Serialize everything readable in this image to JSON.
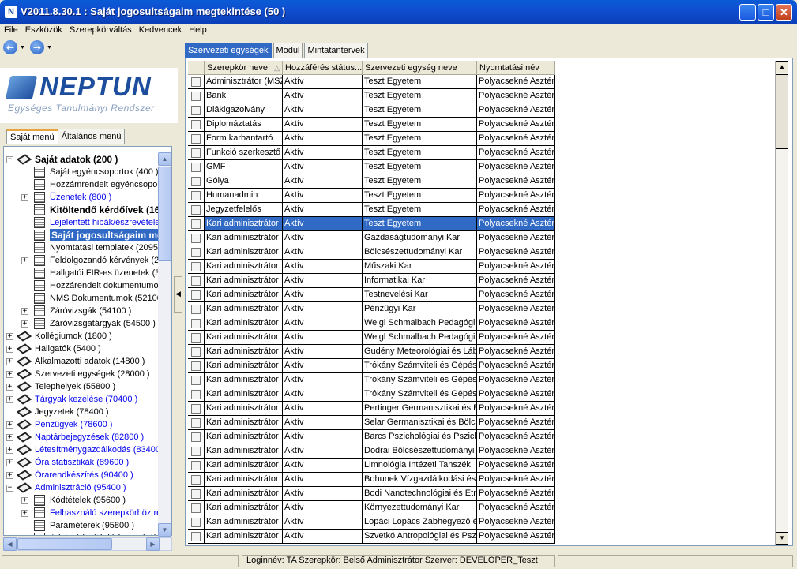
{
  "window": {
    "title": "V2011.8.30.1 : Saját jogosultságaim megtekintése (50  )",
    "app_icon": "N",
    "minimize": "_",
    "maximize": "□",
    "close": "✕"
  },
  "menu": [
    "File",
    "Eszközök",
    "Szerepkörváltás",
    "Kedvencek",
    "Help"
  ],
  "nav": {
    "back": "←",
    "forward": "→",
    "drop": "▼"
  },
  "logo": {
    "name": "NEPTUN",
    "subtitle": "Egységes Tanulmányi Rendszer"
  },
  "left_tabs": [
    "Saját menü",
    "Általános menü"
  ],
  "tree": [
    {
      "label": "Saját adatok (200  )",
      "level": 0,
      "exp": "−",
      "icon": "diamond",
      "style": "bold"
    },
    {
      "label": "Saját egyéncsoportok (400  )",
      "level": 1,
      "exp": "",
      "icon": "doc",
      "style": ""
    },
    {
      "label": "Hozzámrendelt egyéncsoportok",
      "level": 1,
      "exp": "",
      "icon": "doc",
      "style": ""
    },
    {
      "label": "Üzenetek (800  )",
      "level": 1,
      "exp": "+",
      "icon": "doc",
      "style": "link"
    },
    {
      "label": "Kitöltendő kérdőívek (16",
      "level": 1,
      "exp": "",
      "icon": "doc",
      "style": "bold"
    },
    {
      "label": "Lejelentett hibák/észrevételek",
      "level": 1,
      "exp": "",
      "icon": "doc",
      "style": "link"
    },
    {
      "label": "Saját jogosultságaim meg",
      "level": 1,
      "exp": "",
      "icon": "doc",
      "style": "sel"
    },
    {
      "label": "Nyomtatási templatek (20950",
      "level": 1,
      "exp": "",
      "icon": "doc",
      "style": ""
    },
    {
      "label": "Feldolgozandó kérvények (28",
      "level": 1,
      "exp": "+",
      "icon": "doc",
      "style": ""
    },
    {
      "label": "Hallgatói FIR-es üzenetek (32",
      "level": 1,
      "exp": "",
      "icon": "doc",
      "style": ""
    },
    {
      "label": "Hozzárendelt dokumentumok",
      "level": 1,
      "exp": "",
      "icon": "doc",
      "style": ""
    },
    {
      "label": "NMS Dokumentumok (52100",
      "level": 1,
      "exp": "",
      "icon": "doc",
      "style": ""
    },
    {
      "label": "Záróvizsgák (54100  )",
      "level": 1,
      "exp": "+",
      "icon": "doc",
      "style": ""
    },
    {
      "label": "Záróvizsgatárgyak (54500  )",
      "level": 1,
      "exp": "+",
      "icon": "doc",
      "style": ""
    },
    {
      "label": "Kollégiumok (1800  )",
      "level": 0,
      "exp": "+",
      "icon": "diamond",
      "style": ""
    },
    {
      "label": "Hallgatók (5400  )",
      "level": 0,
      "exp": "+",
      "icon": "diamond",
      "style": ""
    },
    {
      "label": "Alkalmazotti adatok (14800  )",
      "level": 0,
      "exp": "+",
      "icon": "diamond",
      "style": ""
    },
    {
      "label": "Szervezeti egységek (28000  )",
      "level": 0,
      "exp": "+",
      "icon": "diamond",
      "style": ""
    },
    {
      "label": "Telephelyek (55800  )",
      "level": 0,
      "exp": "+",
      "icon": "diamond",
      "style": ""
    },
    {
      "label": "Tárgyak kezelése (70400  )",
      "level": 0,
      "exp": "+",
      "icon": "diamond",
      "style": "link"
    },
    {
      "label": "Jegyzetek (78400  )",
      "level": 0,
      "exp": "",
      "icon": "diamond",
      "style": ""
    },
    {
      "label": "Pénzügyek (78600  )",
      "level": 0,
      "exp": "+",
      "icon": "diamond",
      "style": "link"
    },
    {
      "label": "Naptárbejegyzések (82800  )",
      "level": 0,
      "exp": "+",
      "icon": "diamond",
      "style": "link"
    },
    {
      "label": "Létesítménygazdálkodás (83400",
      "level": 0,
      "exp": "+",
      "icon": "diamond",
      "style": "link"
    },
    {
      "label": "Óra statisztikák (89600  )",
      "level": 0,
      "exp": "+",
      "icon": "diamond",
      "style": "link"
    },
    {
      "label": "Órarendkészítés (90400  )",
      "level": 0,
      "exp": "+",
      "icon": "diamond",
      "style": "link"
    },
    {
      "label": "Adminisztráció (95400  )",
      "level": 0,
      "exp": "−",
      "icon": "diamond",
      "style": "link"
    },
    {
      "label": "Kódtételek (95600  )",
      "level": 1,
      "exp": "+",
      "icon": "doc",
      "style": ""
    },
    {
      "label": "Felhasználó szerepkörhöz ren",
      "level": 1,
      "exp": "+",
      "icon": "doc",
      "style": "link"
    },
    {
      "label": "Paraméterek (95800  )",
      "level": 1,
      "exp": "",
      "icon": "doc",
      "style": ""
    },
    {
      "label": "Adatmódosítási kérelmek (96",
      "level": 1,
      "exp": "",
      "icon": "doc",
      "style": ""
    }
  ],
  "right_tabs": [
    "Szervezeti egységek",
    "Modul",
    "Mintatantervek"
  ],
  "grid": {
    "columns": [
      "Szerepkör neve",
      "Hozzáférés státus...",
      "Szervezeti egység neve",
      "Nyomtatási név"
    ],
    "sort_indicator": "△",
    "selected_row": 11,
    "rows": [
      [
        "Adminisztrátor (MSZE",
        "Aktív",
        "Teszt Egyetem",
        "Polyacsekné Asztéria"
      ],
      [
        "Bank",
        "Aktív",
        "Teszt Egyetem",
        "Polyacsekné Asztéria"
      ],
      [
        "Diákigazolvány",
        "Aktív",
        "Teszt Egyetem",
        "Polyacsekné Asztéria"
      ],
      [
        "Diplomáztatás",
        "Aktív",
        "Teszt Egyetem",
        "Polyacsekné Asztéria"
      ],
      [
        "Form karbantartó",
        "Aktív",
        "Teszt Egyetem",
        "Polyacsekné Asztéria"
      ],
      [
        "Funkció szerkesztő",
        "Aktív",
        "Teszt Egyetem",
        "Polyacsekné Asztéria"
      ],
      [
        "GMF",
        "Aktív",
        "Teszt Egyetem",
        "Polyacsekné Asztéria"
      ],
      [
        "Gólya",
        "Aktív",
        "Teszt Egyetem",
        "Polyacsekné Asztéria"
      ],
      [
        "Humanadmin",
        "Aktív",
        "Teszt Egyetem",
        "Polyacsekné Asztéria"
      ],
      [
        "Jegyzetfelelős",
        "Aktív",
        "Teszt Egyetem",
        "Polyacsekné Asztéria"
      ],
      [
        "Kari adminisztrátor",
        "Aktív",
        "Teszt Egyetem",
        "Polyacsekné Asztéria"
      ],
      [
        "Kari adminisztrátor",
        "Aktív",
        "Gazdaságtudományi Kar",
        "Polyacsekné Asztéria"
      ],
      [
        "Kari adminisztrátor",
        "Aktív",
        "Bölcsészettudományi Kar",
        "Polyacsekné Asztéria"
      ],
      [
        "Kari adminisztrátor",
        "Aktív",
        "Műszaki Kar",
        "Polyacsekné Asztéria"
      ],
      [
        "Kari adminisztrátor",
        "Aktív",
        "Informatikai Kar",
        "Polyacsekné Asztéria"
      ],
      [
        "Kari adminisztrátor",
        "Aktív",
        "Testnevelési Kar",
        "Polyacsekné Asztéria"
      ],
      [
        "Kari adminisztrátor",
        "Aktív",
        "Pénzügyi Kar",
        "Polyacsekné Asztéria"
      ],
      [
        "Kari adminisztrátor",
        "Aktív",
        "Weigl Schmalbach Pedagógia",
        "Polyacsekné Asztéria"
      ],
      [
        "Kari adminisztrátor",
        "Aktív",
        "Weigl Schmalbach Pedagógia",
        "Polyacsekné Asztéria"
      ],
      [
        "Kari adminisztrátor",
        "Aktív",
        "Gudény Meteorológiai és Láb",
        "Polyacsekné Asztéria"
      ],
      [
        "Kari adminisztrátor",
        "Aktív",
        "Trókány Számviteli és Gépész",
        "Polyacsekné Asztéria"
      ],
      [
        "Kari adminisztrátor",
        "Aktív",
        "Trókány Számviteli és Gépész",
        "Polyacsekné Asztéria"
      ],
      [
        "Kari adminisztrátor",
        "Aktív",
        "Trókány Számviteli és Gépész",
        "Polyacsekné Asztéria"
      ],
      [
        "Kari adminisztrátor",
        "Aktív",
        "Pertinger Germanisztikai és Bö",
        "Polyacsekné Asztéria"
      ],
      [
        "Kari adminisztrátor",
        "Aktív",
        "Selar Germanisztikai és Bölcse",
        "Polyacsekné Asztéria"
      ],
      [
        "Kari adminisztrátor",
        "Aktív",
        "Barcs Pszichológiai és Pszicho",
        "Polyacsekné Asztéria"
      ],
      [
        "Kari adminisztrátor",
        "Aktív",
        "Dodrai Bölcsészettudományi é",
        "Polyacsekné Asztéria"
      ],
      [
        "Kari adminisztrátor",
        "Aktív",
        "Limnológia Intézeti Tanszék",
        "Polyacsekné Asztéria"
      ],
      [
        "Kari adminisztrátor",
        "Aktív",
        "Bohunek Vízgazdálkodási és",
        "Polyacsekné Asztéria"
      ],
      [
        "Kari adminisztrátor",
        "Aktív",
        "Bodi Nanotechnológiai és Etn",
        "Polyacsekné Asztéria"
      ],
      [
        "Kari adminisztrátor",
        "Aktív",
        "Környezettudományi Kar",
        "Polyacsekné Asztéria"
      ],
      [
        "Kari adminisztrátor",
        "Aktív",
        "Lopáci Lopács Zabhegyező é",
        "Polyacsekné Asztéria"
      ],
      [
        "Kari adminisztrátor",
        "Aktív",
        "Szvetkó Antropológiai és Pszi",
        "Polyacsekné Asztéria"
      ]
    ]
  },
  "status": {
    "text": "Loginnév: TA  Szerepkör: Belső Adminisztrátor  Szerver: DEVELOPER_Teszt"
  },
  "scroll": {
    "up": "▲",
    "down": "▼",
    "left": "◀",
    "right": "▶"
  },
  "splitter_arrow": "◀"
}
